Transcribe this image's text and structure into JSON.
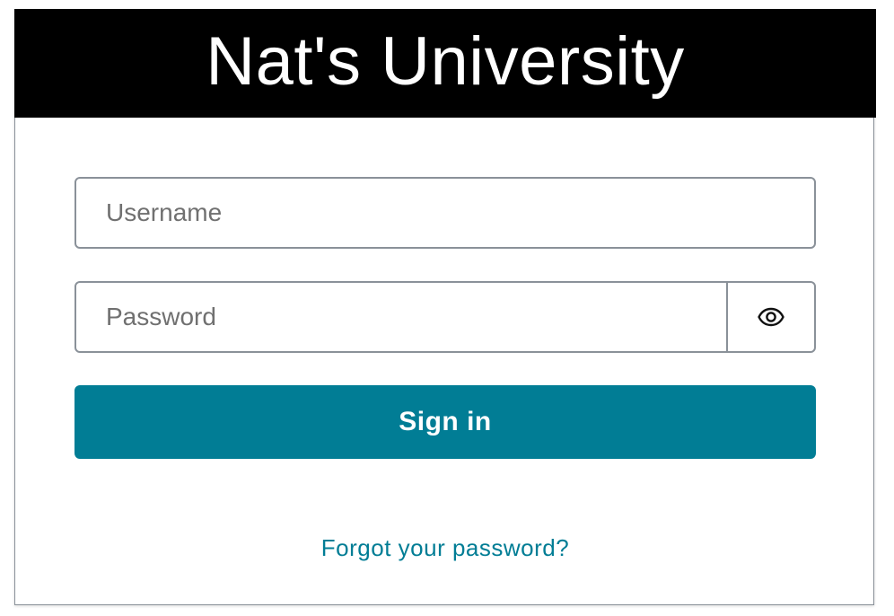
{
  "header": {
    "title": "Nat's University",
    "background_color": "#000000",
    "text_color": "#ffffff"
  },
  "form": {
    "username": {
      "placeholder": "Username",
      "value": ""
    },
    "password": {
      "placeholder": "Password",
      "value": "",
      "toggle_icon": "eye-icon"
    },
    "signin_label": "Sign in",
    "forgot_label": "Forgot your password?"
  },
  "colors": {
    "accent": "#017d95",
    "field_border": "#8a9199",
    "placeholder": "#707070"
  }
}
